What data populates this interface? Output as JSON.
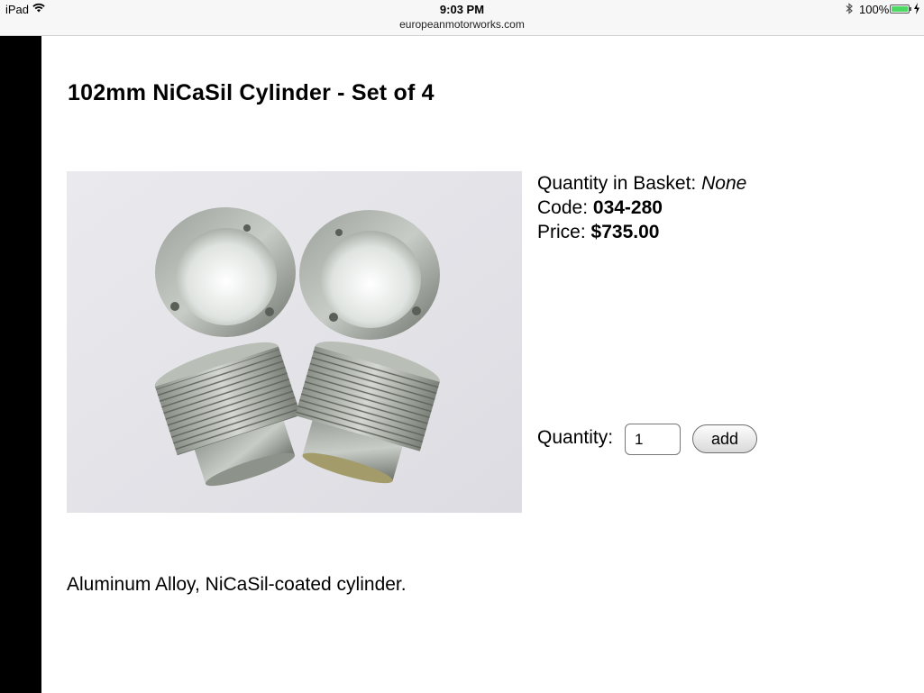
{
  "status_bar": {
    "device": "iPad",
    "time": "9:03 PM",
    "url": "europeanmotorworks.com",
    "battery_percent": "100%",
    "battery_level": 1.0
  },
  "product": {
    "title": "102mm NiCaSil Cylinder - Set of 4",
    "basket_label": "Quantity in Basket:",
    "basket_value": "None",
    "code_label": "Code:",
    "code_value": "034-280",
    "price_label": "Price:",
    "price_value": "$735.00",
    "quantity_label": "Quantity:",
    "quantity_value": "1",
    "add_label": "add",
    "description": "Aluminum Alloy, NiCaSil-coated cylinder."
  },
  "colors": {
    "battery_green": "#4cd964",
    "left_bar": "#000000"
  },
  "icons": [
    "wifi-icon",
    "bluetooth-icon",
    "battery-icon",
    "charging-bolt-icon"
  ]
}
